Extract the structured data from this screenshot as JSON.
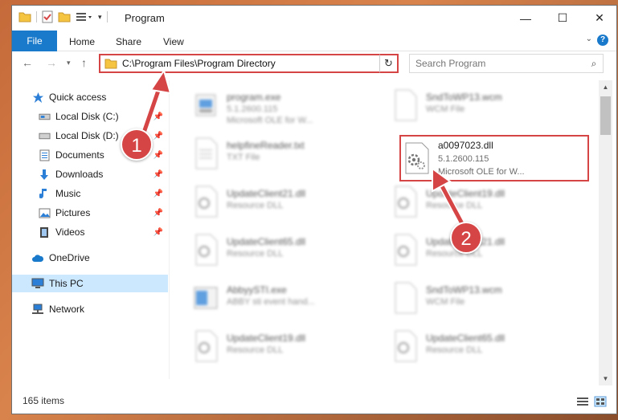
{
  "window": {
    "title": "Program",
    "controls": {
      "minimize": "—",
      "maximize": "☐",
      "close": "✕"
    }
  },
  "ribbon": {
    "tabs": [
      "File",
      "Home",
      "Share",
      "View"
    ],
    "help": "?"
  },
  "address": {
    "path": "C:\\Program Files\\Program Directory",
    "search_placeholder": "Search Program"
  },
  "sidebar": {
    "items": [
      {
        "label": "Quick access",
        "icon": "star-icon"
      },
      {
        "label": "Local Disk (C:)",
        "icon": "drive-icon",
        "pinned": true
      },
      {
        "label": "Local Disk (D:)",
        "icon": "drive-icon",
        "pinned": true
      },
      {
        "label": "Documents",
        "icon": "documents-icon",
        "pinned": true
      },
      {
        "label": "Downloads",
        "icon": "download-icon",
        "pinned": true
      },
      {
        "label": "Music",
        "icon": "music-icon",
        "pinned": true
      },
      {
        "label": "Pictures",
        "icon": "pictures-icon",
        "pinned": true
      },
      {
        "label": "Videos",
        "icon": "videos-icon",
        "pinned": true
      },
      {
        "label": "OneDrive",
        "icon": "cloud-icon"
      },
      {
        "label": "This PC",
        "icon": "computer-icon",
        "selected": true
      },
      {
        "label": "Network",
        "icon": "network-icon"
      }
    ]
  },
  "files": [
    {
      "name": "program.exe",
      "line2": "5.1.2600.115",
      "line3": "Microsoft OLE for W...",
      "kind": "exe",
      "blurred": true
    },
    {
      "name": "SndToWP13.wcm",
      "line2": "WCM File",
      "line3": "",
      "kind": "blank",
      "blurred": true
    },
    {
      "name": "helpfineReader.txt",
      "line2": "TXT File",
      "line3": "",
      "kind": "txt",
      "blurred": true
    },
    {
      "name": "a0097023.dll",
      "line2": "5.1.2600.115",
      "line3": "Microsoft OLE for W...",
      "kind": "dll",
      "blurred": false,
      "highlight": true
    },
    {
      "name": "UpdateClient21.dll",
      "line2": "Resource DLL",
      "line3": "",
      "kind": "dll",
      "blurred": true
    },
    {
      "name": "UpdateClient19.dll",
      "line2": "Resource DLL",
      "line3": "",
      "kind": "dll",
      "blurred": true
    },
    {
      "name": "UpdateClient65.dll",
      "line2": "Resource DLL",
      "line3": "",
      "kind": "dll",
      "blurred": true
    },
    {
      "name": "UpdateClient21.dll",
      "line2": "Resource DLL",
      "line3": "",
      "kind": "dll",
      "blurred": true
    },
    {
      "name": "AbbyySTI.exe",
      "line2": "ABBY sti event hand...",
      "line3": "",
      "kind": "app",
      "blurred": true
    },
    {
      "name": "SndToWP13.wcm",
      "line2": "WCM File",
      "line3": "",
      "kind": "blank",
      "blurred": true
    },
    {
      "name": "UpdateClient19.dll",
      "line2": "Resource DLL",
      "line3": "",
      "kind": "dll",
      "blurred": true
    },
    {
      "name": "UpdateClient65.dll",
      "line2": "Resource DLL",
      "line3": "",
      "kind": "dll",
      "blurred": true
    }
  ],
  "status": {
    "item_count": "165 items"
  },
  "callouts": [
    "1",
    "2"
  ],
  "colors": {
    "accent": "#1979ca",
    "highlight": "#d64545",
    "selected": "#cce8ff"
  }
}
